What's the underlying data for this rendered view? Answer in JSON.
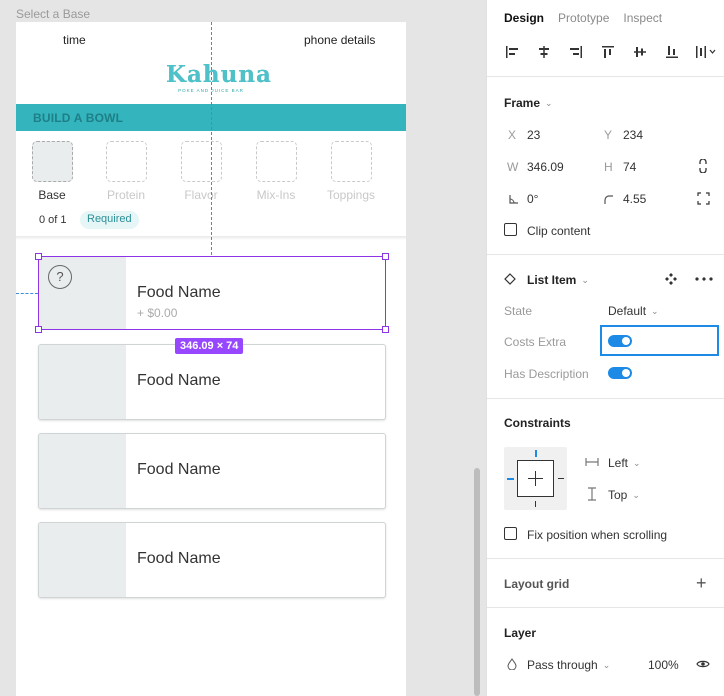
{
  "canvas": {
    "frame_label": "Select a Base",
    "status": {
      "time": "time",
      "phone": "phone details"
    },
    "logo": {
      "title": "Kahuna",
      "subtitle": "POKE AND JUICE BAR"
    },
    "build_label": "BUILD A BOWL",
    "steps": [
      {
        "label": "Base",
        "active": true
      },
      {
        "label": "Protein",
        "active": false
      },
      {
        "label": "Flavor",
        "active": false
      },
      {
        "label": "Mix-Ins",
        "active": false
      },
      {
        "label": "Toppings",
        "active": false
      }
    ],
    "count": "0 of 1",
    "required": "Required",
    "items": [
      {
        "name": "Food Name",
        "price": "+ $0.00",
        "help": "?"
      },
      {
        "name": "Food Name"
      },
      {
        "name": "Food Name"
      },
      {
        "name": "Food Name"
      }
    ],
    "selection_size": "346.09 × 74"
  },
  "panel": {
    "tabs": [
      "Design",
      "Prototype",
      "Inspect"
    ],
    "align_icons": [
      "align-left-icon",
      "align-horizontal-center-icon",
      "align-right-icon",
      "align-top-icon",
      "align-vertical-center-icon",
      "align-bottom-icon",
      "distribute-icon"
    ],
    "frame": {
      "title": "Frame",
      "x_label": "X",
      "x": "23",
      "y_label": "Y",
      "y": "234",
      "w_label": "W",
      "w": "346.09",
      "h_label": "H",
      "h": "74",
      "rotation": "0°",
      "radius": "4.55",
      "clip_content": "Clip content"
    },
    "component": {
      "title": "List Item",
      "state_label": "State",
      "state_value": "Default",
      "costs_extra_label": "Costs Extra",
      "costs_extra": true,
      "has_description_label": "Has Description",
      "has_description": true
    },
    "constraints": {
      "title": "Constraints",
      "horizontal": "Left",
      "vertical": "Top",
      "fix_position": "Fix position when scrolling"
    },
    "layout_grid": {
      "title": "Layout grid"
    },
    "layer": {
      "title": "Layer",
      "blend": "Pass through",
      "opacity": "100%"
    },
    "colors": {
      "accent": "#1d8be6",
      "selection": "#9747ff",
      "brand": "#34b4bd"
    }
  }
}
